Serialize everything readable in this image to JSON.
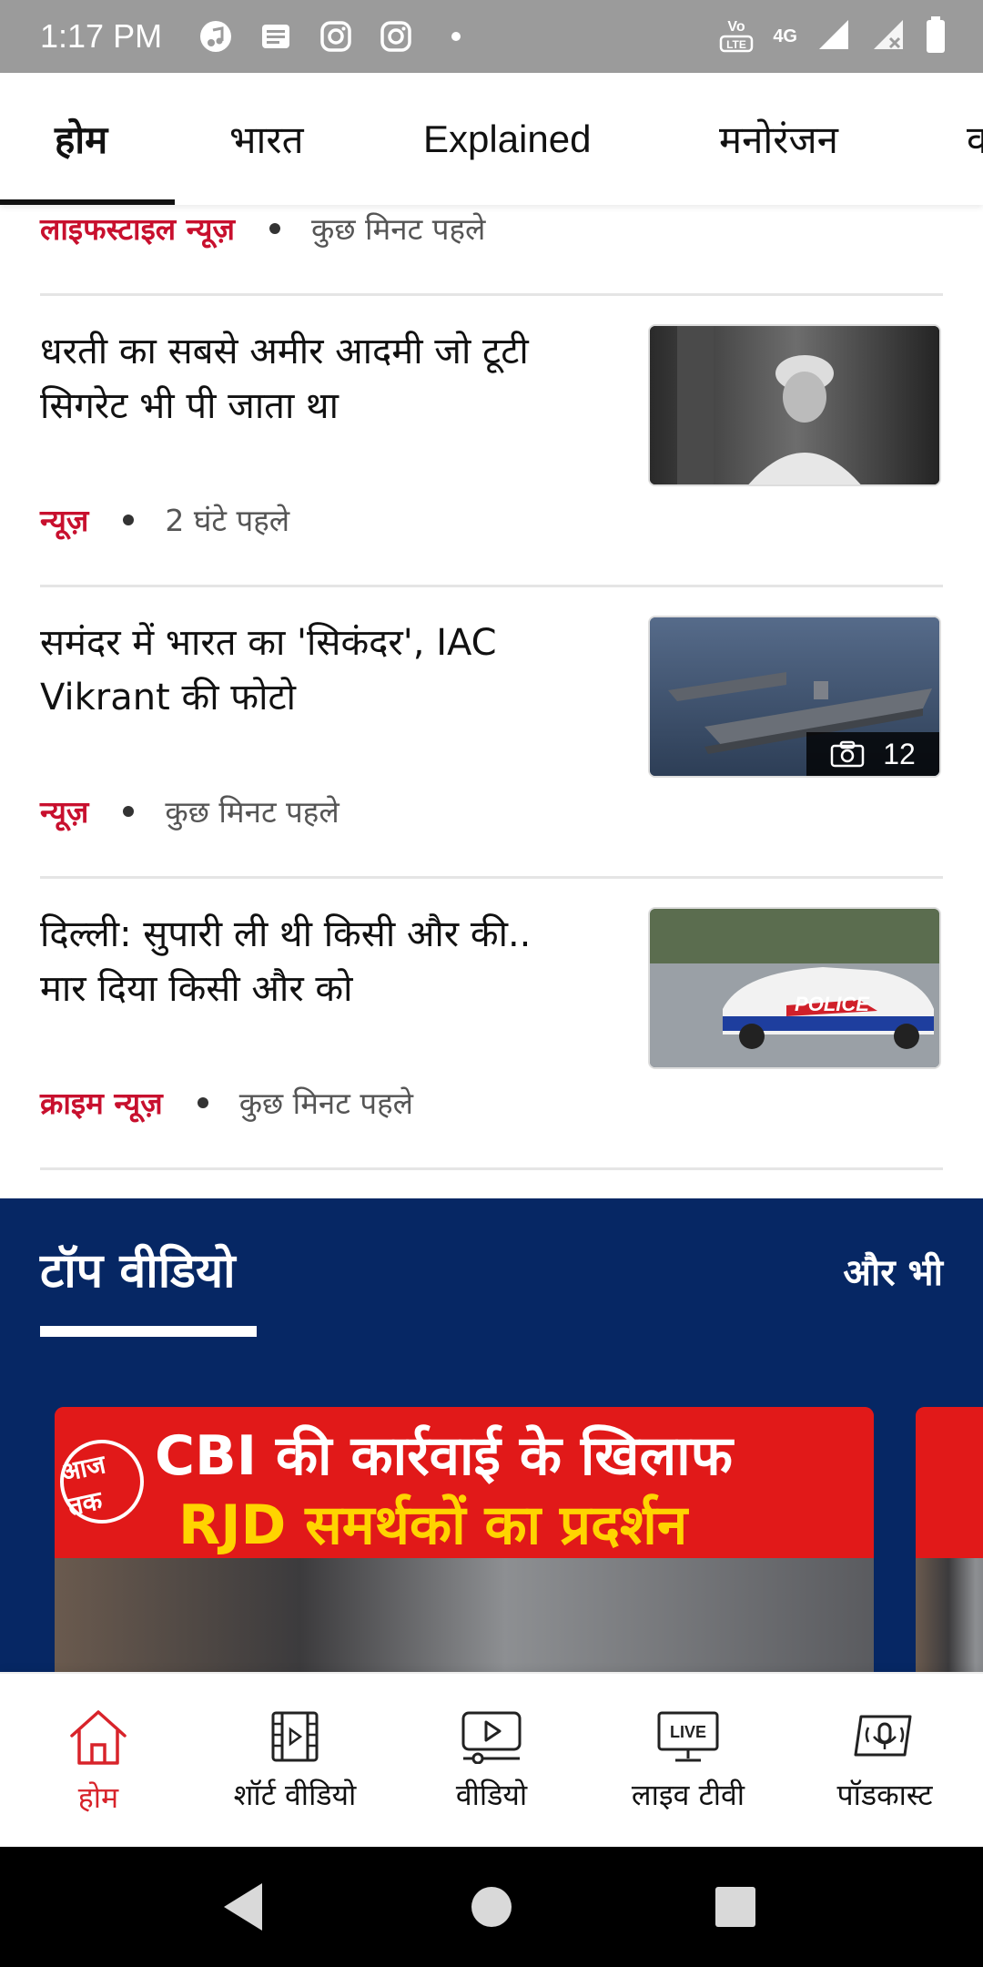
{
  "status_bar": {
    "time": "1:17 PM",
    "network_label": "4G",
    "volte_label": "VoLTE",
    "icons": [
      "music-icon",
      "news-icon",
      "instagram-icon",
      "instagram-icon",
      "dot-icon",
      "volte-icon",
      "signal-icon",
      "battery-icon"
    ]
  },
  "tabs": [
    {
      "label": "होम",
      "active": true
    },
    {
      "label": "भारत",
      "active": false
    },
    {
      "label": "Explained",
      "active": false
    },
    {
      "label": "मनोरंजन",
      "active": false
    },
    {
      "label": "व",
      "active": false
    }
  ],
  "articles": [
    {
      "category": "लाइफस्टाइल न्यूज़",
      "time_ago": "कुछ मिनट पहले"
    },
    {
      "headline": "धरती का सबसे अमीर आदमी जो टूटी सिगरेट भी पी जाता था",
      "category": "न्यूज़",
      "time_ago": "2 घंटे पहले",
      "thumb": "portrait-photo"
    },
    {
      "headline": "समंदर में भारत का 'सिकंदर', IAC Vikrant की फोटो",
      "category": "न्यूज़",
      "time_ago": "कुछ मिनट पहले",
      "thumb": "warship-photo",
      "photo_count": "12"
    },
    {
      "headline": "दिल्ली: सुपारी ली थी किसी और की.. मार दिया किसी और को",
      "category": "क्राइम न्यूज़",
      "time_ago": "कुछ मिनट पहले",
      "thumb": "police-car-photo"
    }
  ],
  "top_video": {
    "title": "टॉप वीडियो",
    "more": "और भी",
    "card": {
      "line1": "CBI की कार्रवाई के खिलाफ",
      "line2": "RJD समर्थकों का प्रदर्शन",
      "logo": "आज तक"
    }
  },
  "bottom_nav": [
    {
      "label": "होम",
      "icon": "home-icon",
      "active": true
    },
    {
      "label": "शॉर्ट वीडियो",
      "icon": "short-video-icon",
      "active": false
    },
    {
      "label": "वीडियो",
      "icon": "video-icon",
      "active": false
    },
    {
      "label": "लाइव टीवी",
      "icon": "live-tv-icon",
      "live_text": "LIVE",
      "active": false
    },
    {
      "label": "पॉडकास्ट",
      "icon": "podcast-icon",
      "active": false
    }
  ],
  "colors": {
    "accent_red": "#c8102e",
    "navy": "#062764",
    "statusbar_gray": "#9b9b9b"
  }
}
